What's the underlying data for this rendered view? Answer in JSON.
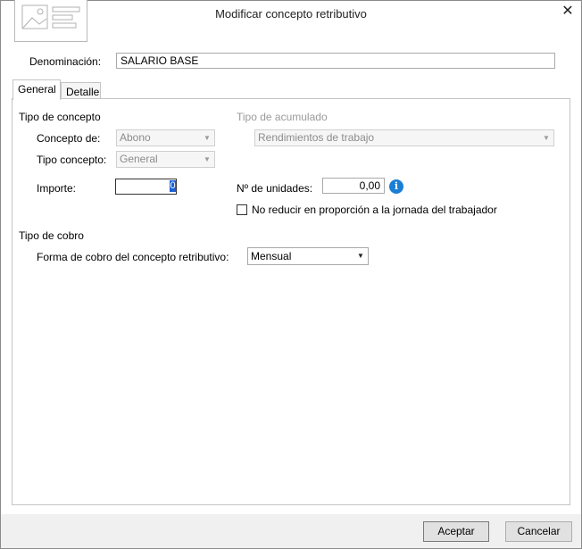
{
  "window": {
    "title": "Modificar concepto retributivo",
    "close_icon": "close-icon",
    "logo_icon": "image-placeholder-icon"
  },
  "header": {
    "denominacion_label": "Denominación:",
    "denominacion_value": "SALARIO BASE"
  },
  "tabs": [
    {
      "label": "General",
      "active": true
    },
    {
      "label": "Detalle",
      "active": false
    }
  ],
  "general": {
    "tipo_concepto_heading": "Tipo de concepto",
    "tipo_acumulado_heading": "Tipo de acumulado",
    "concepto_de_label": "Concepto de:",
    "concepto_de_value": "Abono",
    "tipo_concepto_label": "Tipo concepto:",
    "tipo_concepto_value": "General",
    "tipo_acumulado_value": "Rendimientos de trabajo",
    "importe_label": "Importe:",
    "importe_value": "0",
    "unidades_label": "Nº de unidades:",
    "unidades_value": "0,00",
    "info_icon": "info-icon",
    "no_reducir_label": "No reducir en proporción a la jornada del trabajador",
    "no_reducir_checked": false,
    "tipo_cobro_heading": "Tipo de cobro",
    "forma_cobro_label": "Forma de cobro del concepto retributivo:",
    "forma_cobro_value": "Mensual"
  },
  "footer": {
    "accept_label": "Aceptar",
    "cancel_label": "Cancelar"
  },
  "colors": {
    "info_blue": "#1a7fd4",
    "footer_bg": "#f0f0f0",
    "disabled_text": "#9a9a9a"
  }
}
